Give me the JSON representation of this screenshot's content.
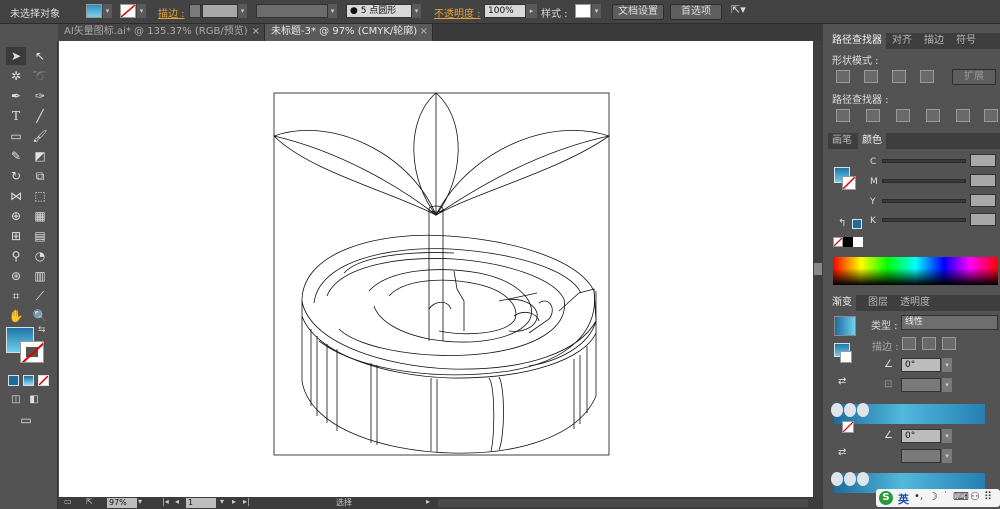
{
  "control_bar": {
    "selection_status": "未选择对象",
    "stroke_label": "描边 :",
    "brush_value": "5 点圆形",
    "opacity_label": "不透明度 :",
    "opacity_value": "100%",
    "style_label": "样式 :",
    "doc_setup_button": "文档设置",
    "preferences_button": "首选项"
  },
  "tabs": [
    {
      "label": "AI矢量图标.ai* @ 135.37% (RGB/预览)",
      "close": "×"
    },
    {
      "label": "未标题-3* @ 97% (CMYK/轮廓)",
      "close": "×"
    }
  ],
  "status_bar": {
    "zoom": "97%",
    "page": "1",
    "tool_status": "选择"
  },
  "pathfinder_panel": {
    "tabs": [
      "路径查找器",
      "对齐",
      "描边",
      "符号"
    ],
    "shape_modes_label": "形状模式 :",
    "expand_button": "扩展",
    "pathfinders_label": "路径查找器 :"
  },
  "color_panel": {
    "tabs": [
      "画笔",
      "颜色"
    ],
    "channels": [
      "C",
      "M",
      "Y",
      "K"
    ]
  },
  "gradient_panel": {
    "tabs": [
      "渐变",
      "图层",
      "透明度"
    ],
    "type_label": "类型 :",
    "type_value": "线性",
    "stroke_label": "描边 :",
    "angle_value": "0°",
    "angle_value_2": "0°"
  },
  "ime": {
    "logo": "S",
    "lang": "英"
  },
  "colors": {
    "accent_orange": "#e3a335",
    "gradient_start": "#1e6c9e",
    "gradient_mid": "#51b8dc"
  }
}
